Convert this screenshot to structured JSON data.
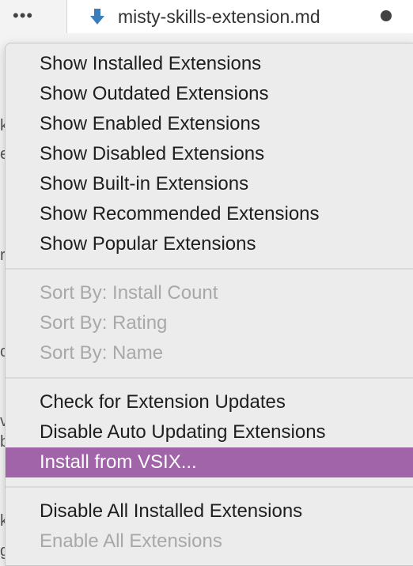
{
  "topbar": {
    "more_glyph": "•••",
    "tab": {
      "file_name": "misty-skills-extension.md"
    }
  },
  "menu": {
    "items": [
      {
        "label": "Show Installed Extensions",
        "state": "enabled"
      },
      {
        "label": "Show Outdated Extensions",
        "state": "enabled"
      },
      {
        "label": "Show Enabled Extensions",
        "state": "enabled"
      },
      {
        "label": "Show Disabled Extensions",
        "state": "enabled"
      },
      {
        "label": "Show Built-in Extensions",
        "state": "enabled"
      },
      {
        "label": "Show Recommended Extensions",
        "state": "enabled"
      },
      {
        "label": "Show Popular Extensions",
        "state": "enabled"
      },
      {
        "label": "Sort By: Install Count",
        "state": "disabled"
      },
      {
        "label": "Sort By: Rating",
        "state": "disabled"
      },
      {
        "label": "Sort By: Name",
        "state": "disabled"
      },
      {
        "label": "Check for Extension Updates",
        "state": "enabled"
      },
      {
        "label": "Disable Auto Updating Extensions",
        "state": "enabled"
      },
      {
        "label": "Install from VSIX...",
        "state": "highlighted"
      },
      {
        "label": "Disable All Installed Extensions",
        "state": "enabled"
      },
      {
        "label": "Enable All Extensions",
        "state": "disabled"
      }
    ]
  },
  "colors": {
    "highlight": "#a164a9",
    "menu_bg": "#ececec",
    "disabled_text": "#a8a8a8",
    "file_icon": "#3b7dbb"
  }
}
